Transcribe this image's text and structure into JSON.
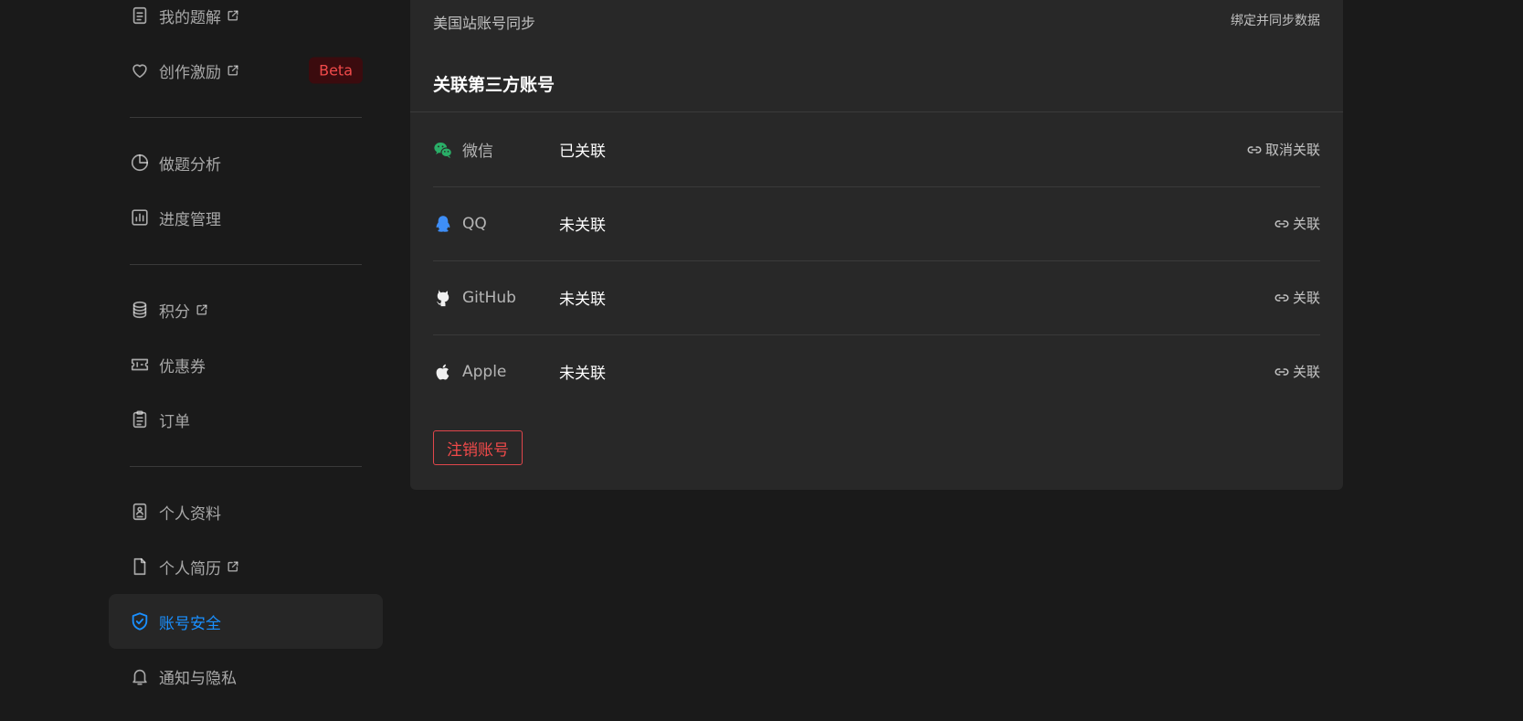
{
  "sidebar": {
    "items": [
      {
        "label": "我的题解",
        "icon": "document-icon",
        "external": true
      },
      {
        "label": "创作激励",
        "icon": "heart-icon",
        "external": true,
        "badge": "Beta"
      },
      {
        "label": "做题分析",
        "icon": "pie-chart-icon"
      },
      {
        "label": "进度管理",
        "icon": "bar-chart-icon"
      },
      {
        "label": "积分",
        "icon": "coins-icon",
        "external": true
      },
      {
        "label": "优惠券",
        "icon": "ticket-icon"
      },
      {
        "label": "订单",
        "icon": "clipboard-icon"
      },
      {
        "label": "个人资料",
        "icon": "id-card-icon"
      },
      {
        "label": "个人简历",
        "icon": "file-icon",
        "external": true
      },
      {
        "label": "账号安全",
        "icon": "shield-check-icon",
        "active": true
      },
      {
        "label": "通知与隐私",
        "icon": "bell-icon"
      }
    ]
  },
  "main": {
    "sync": {
      "label": "美国站账号同步",
      "action": "绑定并同步数据"
    },
    "section_title": "关联第三方账号",
    "accounts": [
      {
        "name": "微信",
        "icon": "wechat-icon",
        "status": "已关联",
        "action": "取消关联"
      },
      {
        "name": "QQ",
        "icon": "qq-icon",
        "status": "未关联",
        "action": "关联"
      },
      {
        "name": "GitHub",
        "icon": "github-icon",
        "status": "未关联",
        "action": "关联"
      },
      {
        "name": "Apple",
        "icon": "apple-icon",
        "status": "未关联",
        "action": "关联"
      }
    ],
    "delete_button": "注销账号"
  },
  "colors": {
    "page_bg": "#1a1a1a",
    "panel_bg": "#282828",
    "active_blue": "#1a90ff",
    "danger_red": "#f04a4a",
    "wechat_green": "#2aae67",
    "qq_blue": "#3e8ef7"
  }
}
